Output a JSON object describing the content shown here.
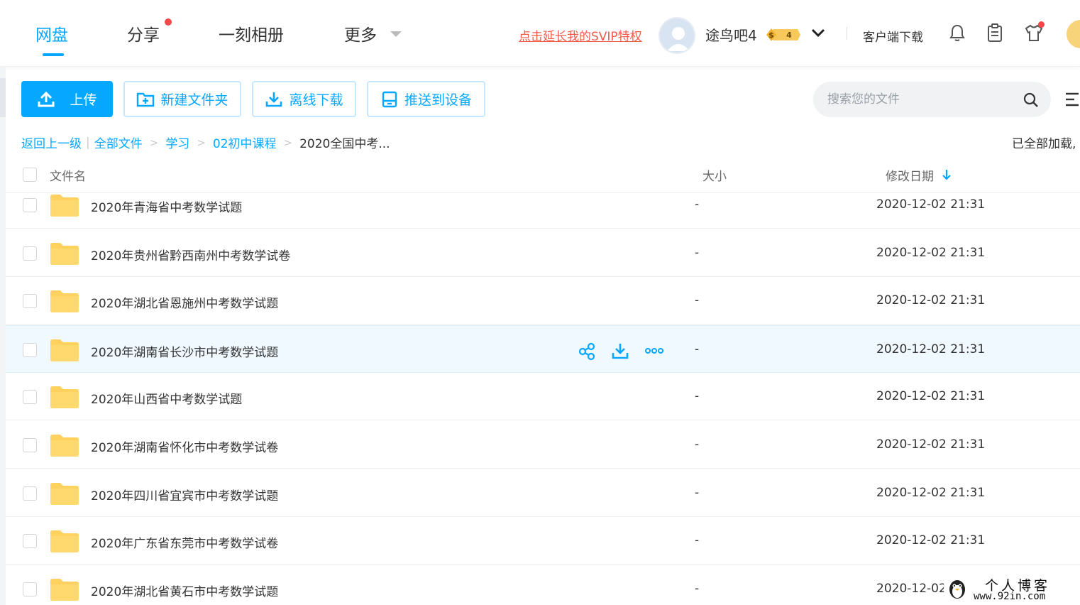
{
  "nav": {
    "tabs": [
      {
        "label": "网盘",
        "active": true
      },
      {
        "label": "分享",
        "badge_dot": true
      },
      {
        "label": "一刻相册"
      },
      {
        "label": "更多"
      }
    ],
    "svip_link": "点击延长我的SVIP特权",
    "username": "途鸟吧4",
    "vip_level": "4",
    "client_download": "客户端下载",
    "icons": [
      "bell-icon",
      "clipboard-icon",
      "shirt-icon"
    ]
  },
  "toolbar": {
    "upload": "上传",
    "new_folder": "新建文件夹",
    "offline_download": "离线下载",
    "push_device": "推送到设备",
    "search_placeholder": "搜索您的文件"
  },
  "breadcrumb": {
    "back": "返回上一级",
    "items": [
      "全部文件",
      "学习",
      "02初中课程"
    ],
    "current": "2020全国中考...",
    "loaded": "已全部加载,"
  },
  "table": {
    "headers": {
      "name": "文件名",
      "size": "大小",
      "date": "修改日期"
    },
    "rows": [
      {
        "name": "2020年青海省中考数学试题",
        "size": "-",
        "date": "2020-12-02 21:31"
      },
      {
        "name": "2020年贵州省黔西南州中考数学试卷",
        "size": "-",
        "date": "2020-12-02 21:31"
      },
      {
        "name": "2020年湖北省恩施州中考数学试题",
        "size": "-",
        "date": "2020-12-02 21:31"
      },
      {
        "name": "2020年湖南省长沙市中考数学试题",
        "size": "-",
        "date": "2020-12-02 21:31",
        "hovered": true
      },
      {
        "name": "2020年山西省中考数学试题",
        "size": "-",
        "date": "2020-12-02 21:31"
      },
      {
        "name": "2020年湖南省怀化市中考数学试卷",
        "size": "-",
        "date": "2020-12-02 21:31"
      },
      {
        "name": "2020年四川省宜宾市中考数学试题",
        "size": "-",
        "date": "2020-12-02 21:31"
      },
      {
        "name": "2020年广东省东莞市中考数学试卷",
        "size": "-",
        "date": "2020-12-02 21:31"
      },
      {
        "name": "2020年湖北省黄石市中考数学试题",
        "size": "-",
        "date": "2020-12-02"
      }
    ]
  },
  "watermark": {
    "title": "个人博客",
    "url": "www.92in.com"
  },
  "colors": {
    "accent": "#06a7ff",
    "alert": "#f25a4a",
    "folder": "#ffd260"
  }
}
